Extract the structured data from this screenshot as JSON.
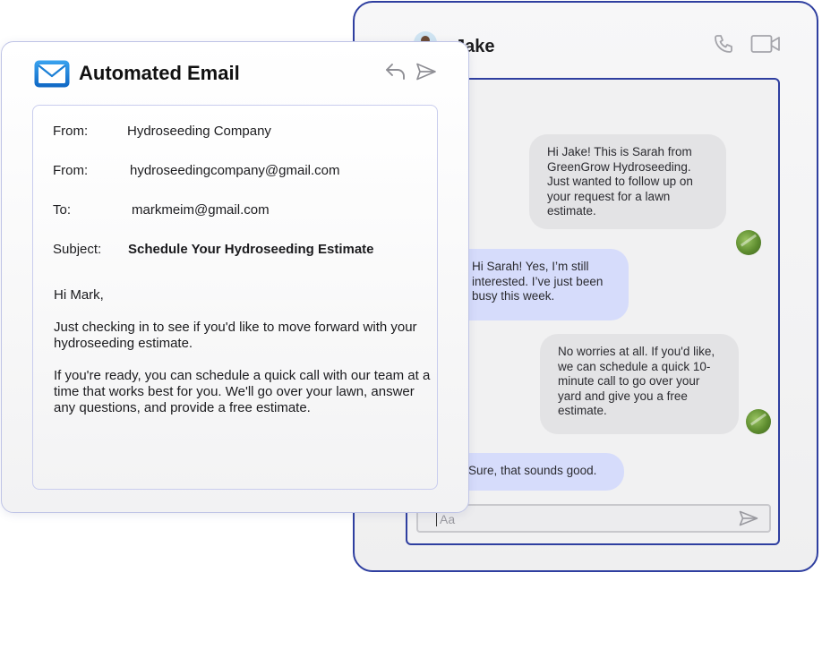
{
  "chat": {
    "contact_name": "Jake",
    "icons": {
      "call": "phone-icon",
      "video": "video-camera-icon",
      "send": "send-icon"
    },
    "messages": [
      {
        "direction": "incoming",
        "text": "Hi Jake! This is Sarah from GreenGrow Hydroseeding. Just wanted to follow up on your request for a lawn estimate."
      },
      {
        "direction": "outgoing",
        "text": "Hi Sarah! Yes, I’m still interested. I’ve just been busy this week."
      },
      {
        "direction": "incoming",
        "text": "No worries at all. If you'd like, we can schedule a quick 10-minute call to go over your yard and give you a free estimate."
      },
      {
        "direction": "outgoing",
        "text": "Sure, that sounds good."
      }
    ],
    "input": {
      "placeholder": "Aa"
    }
  },
  "email": {
    "title": "Automated Email",
    "icons": {
      "logo": "mail-icon",
      "reply": "reply-icon",
      "forward": "forward-icon"
    },
    "fields": [
      {
        "label": "From:",
        "value": "Hydroseeding Company"
      },
      {
        "label": "From:",
        "value": "hydroseedingcompany@gmail.com"
      },
      {
        "label": "To:",
        "value": "markmeim@gmail.com"
      },
      {
        "label": "Subject:",
        "value": "Schedule Your Hydroseeding Estimate"
      }
    ],
    "greeting": "Hi Mark,",
    "paragraphs": [
      "Just checking in to see if you'd like to move forward with your hydroseeding estimate.",
      "If you're ready, you can schedule a quick call with our team at a time that works best for you. We'll go over your lawn, answer any questions, and provide a free estimate."
    ]
  },
  "colors": {
    "accent_border": "#2f3fa0",
    "incoming_bubble": "#e3e3e5",
    "outgoing_bubble": "#d6dcfb",
    "mail_icon": "#1a7fd6"
  }
}
